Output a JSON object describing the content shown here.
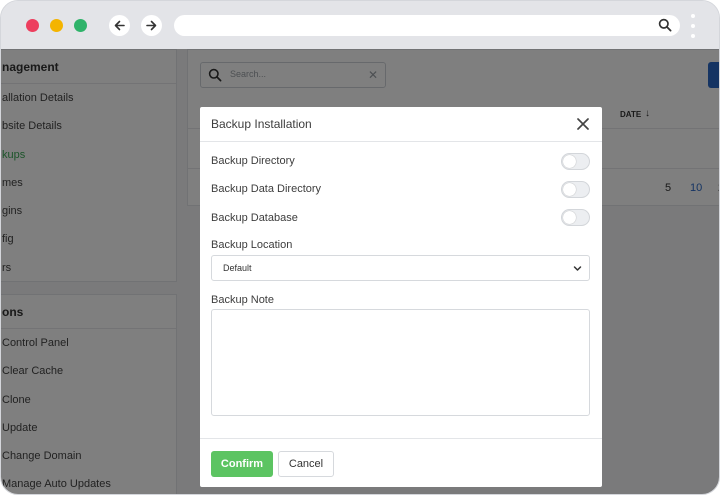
{
  "sidebar": {
    "management": {
      "title": "nagement",
      "items": [
        {
          "label": "allation Details"
        },
        {
          "label": "bsite Details"
        },
        {
          "label": "kups"
        },
        {
          "label": "mes"
        },
        {
          "label": "gins"
        },
        {
          "label": "fig"
        },
        {
          "label": "rs"
        }
      ]
    },
    "actions": {
      "title": "ons",
      "items": [
        {
          "label": "Control Panel"
        },
        {
          "label": "Clear Cache"
        },
        {
          "label": "Clone"
        },
        {
          "label": "Update"
        },
        {
          "label": "Change Domain"
        },
        {
          "label": "Manage Auto Updates"
        }
      ]
    }
  },
  "table": {
    "search_placeholder": "Search...",
    "date_column": "DATE",
    "page_sizes": [
      "5",
      "10",
      "2"
    ]
  },
  "modal": {
    "title": "Backup Installation",
    "backup_directory_label": "Backup Directory",
    "backup_data_directory_label": "Backup Data Directory",
    "backup_database_label": "Backup Database",
    "backup_location_label": "Backup Location",
    "backup_location_value": "Default",
    "backup_note_label": "Backup Note",
    "backup_note_value": "",
    "confirm_label": "Confirm",
    "cancel_label": "Cancel",
    "toggles": {
      "backup_directory": false,
      "backup_data_directory": false,
      "backup_database": false
    }
  },
  "colors": {
    "accent_green": "#5cc462",
    "active_link": "#3aaa56",
    "primary_blue": "#2b69c7"
  }
}
